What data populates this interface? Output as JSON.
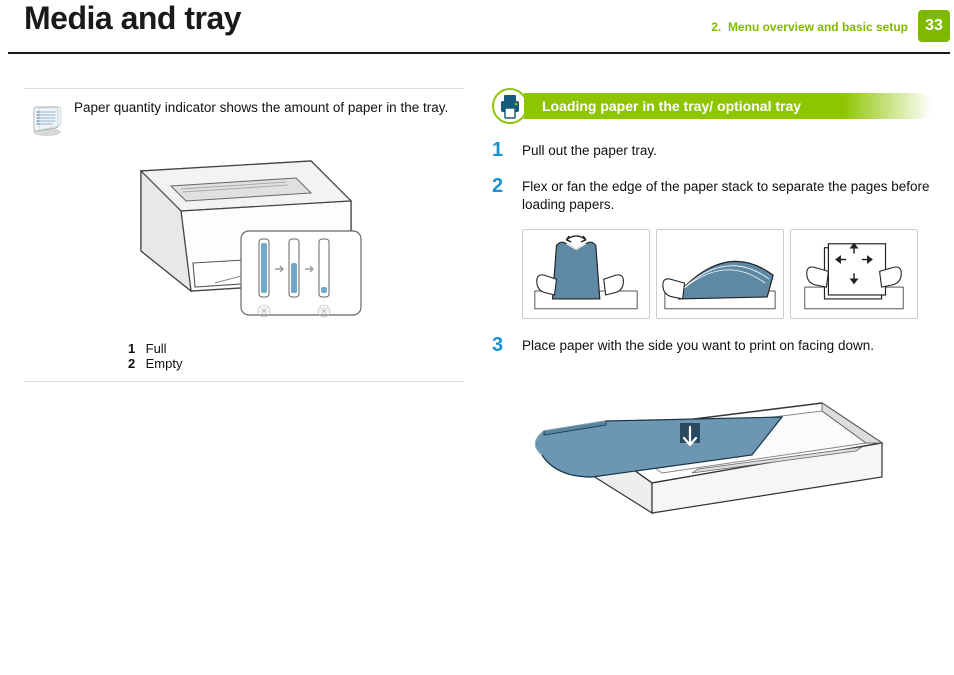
{
  "header": {
    "title": "Media and tray",
    "chapter": "2.",
    "chapter_label": "Menu overview and basic setup",
    "page": "33"
  },
  "left": {
    "note": "Paper quantity indicator shows the amount of paper in the tray.",
    "legend": [
      {
        "n": "1",
        "label": "Full"
      },
      {
        "n": "2",
        "label": "Empty"
      }
    ]
  },
  "right": {
    "section_title": "Loading paper in the tray/ optional tray",
    "steps": [
      {
        "n": "1",
        "text": "Pull out the paper tray."
      },
      {
        "n": "2",
        "text": "Flex or fan the edge of the paper stack to separate the pages before loading papers."
      },
      {
        "n": "3",
        "text": "Place paper with the side you want to print on facing down."
      }
    ]
  }
}
